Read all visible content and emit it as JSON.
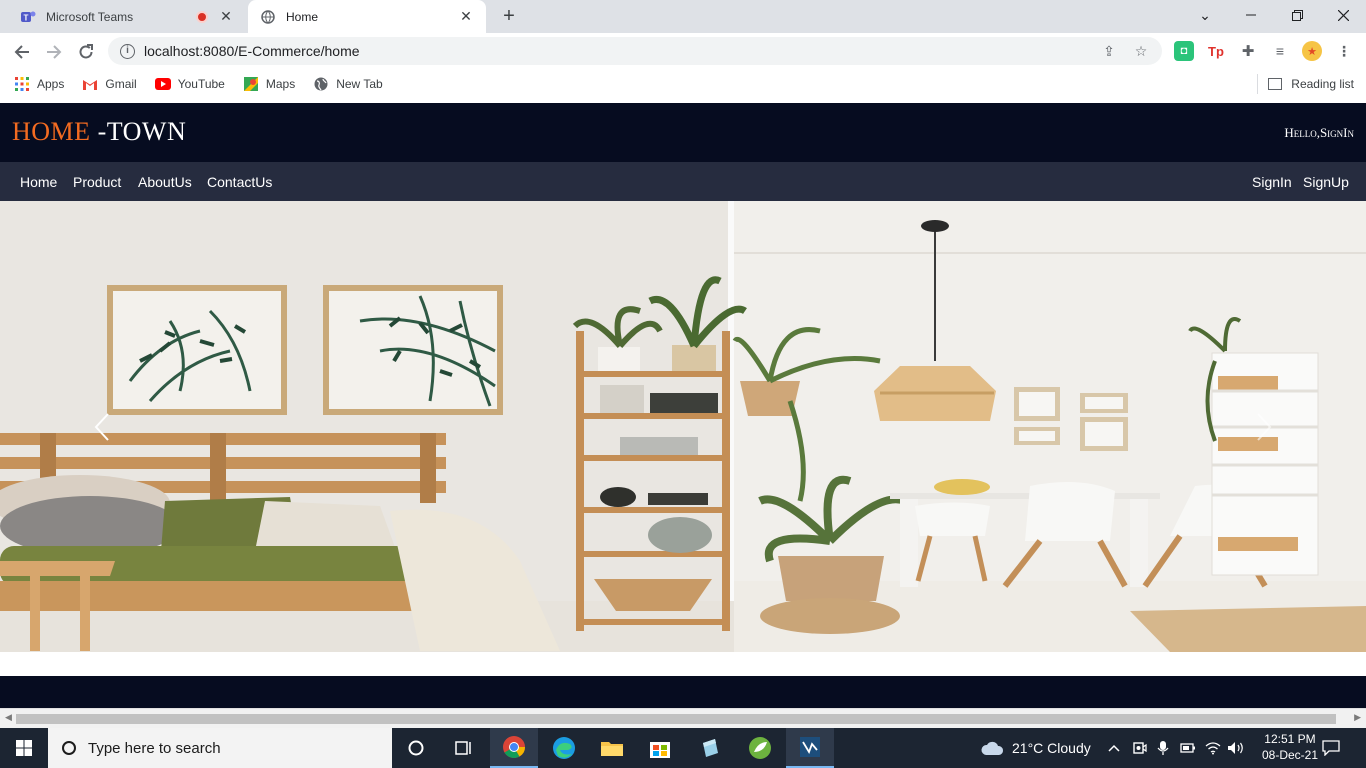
{
  "browser": {
    "tabs": [
      {
        "title": "Microsoft Teams",
        "recording": true
      },
      {
        "title": "Home",
        "active": true
      }
    ],
    "new_tab_symbol": "+",
    "url": "localhost:8080/E-Commerce/home",
    "bookmarks": [
      {
        "label": "Apps",
        "icon": "apps-grid-icon"
      },
      {
        "label": "Gmail",
        "icon": "gmail-icon"
      },
      {
        "label": "YouTube",
        "icon": "youtube-icon"
      },
      {
        "label": "Maps",
        "icon": "maps-icon"
      },
      {
        "label": "New Tab",
        "icon": "globe-icon"
      }
    ],
    "reading_list": "Reading list"
  },
  "site": {
    "brand_part1": "HOME",
    "brand_part2": " -TOWN",
    "greeting": "Hello,SignIn",
    "nav_left": [
      "Home",
      "Product",
      "AboutUs",
      "ContactUs"
    ],
    "nav_right": [
      "SignIn",
      "SignUp"
    ],
    "colors": {
      "header_bg": "#060c20",
      "nav_bg": "#262c3f",
      "brand_accent": "#f36b21"
    },
    "hero": {
      "description_icon": "living-room-photo",
      "prev_icon": "chevron-left-icon",
      "next_icon": "chevron-right-icon"
    }
  },
  "taskbar": {
    "search_placeholder": "Type here to search",
    "weather": "21°C  Cloudy",
    "time": "12:51 PM",
    "date": "08-Dec-21"
  }
}
